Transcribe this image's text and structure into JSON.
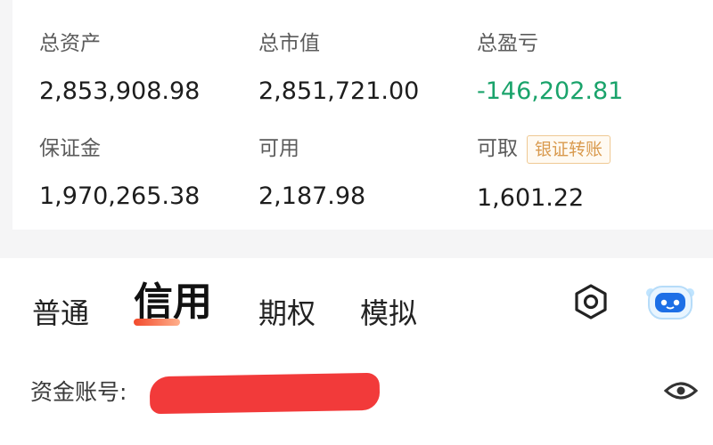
{
  "summary": {
    "total_assets": {
      "label": "总资产",
      "value": "2,853,908.98"
    },
    "market_value": {
      "label": "总市值",
      "value": "2,851,721.00"
    },
    "total_pnl": {
      "label": "总盈亏",
      "value": "-146,202.81"
    },
    "margin": {
      "label": "保证金",
      "value": "1,970,265.38"
    },
    "available": {
      "label": "可用",
      "value": "2,187.98"
    },
    "withdrawable": {
      "label": "可取",
      "value": "1,601.22",
      "transfer_button": "银证转账"
    }
  },
  "tabs": [
    {
      "label": "普通"
    },
    {
      "label": "信用",
      "active": true
    },
    {
      "label": "期权"
    },
    {
      "label": "模拟"
    }
  ],
  "account": {
    "label": "资金账号:"
  },
  "icons": {
    "settings": "hexagon-gear-icon",
    "assistant": "robot-assistant-icon",
    "visibility": "eye-icon"
  },
  "colors": {
    "loss": "#1aa36b",
    "transfer_button": "#d99a4e",
    "tab_underline": "#f24a2c",
    "redaction": "#f23a3a"
  }
}
